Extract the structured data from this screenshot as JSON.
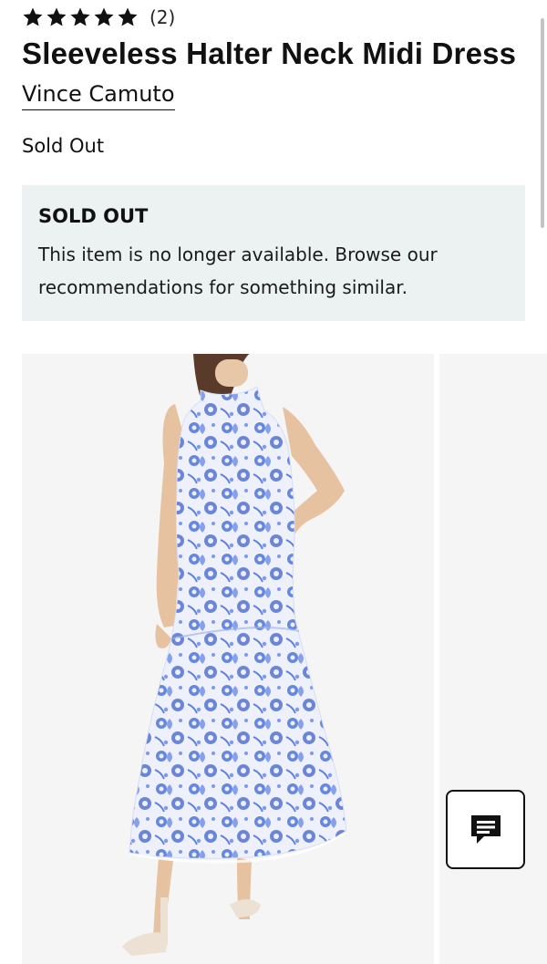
{
  "rating": {
    "stars": 5,
    "count_text": "(2)"
  },
  "product": {
    "title": "Sleeveless Halter Neck Midi Dress",
    "brand": "Vince Camuto",
    "status": "Sold Out"
  },
  "notice": {
    "title": "SOLD OUT",
    "body": "This item is no longer available. Browse our recommendations for something similar."
  },
  "gallery": {
    "dress_colors": {
      "base": "#eef1fb",
      "print": "#4f75db"
    }
  },
  "chat": {
    "icon": "chat-message-icon"
  }
}
